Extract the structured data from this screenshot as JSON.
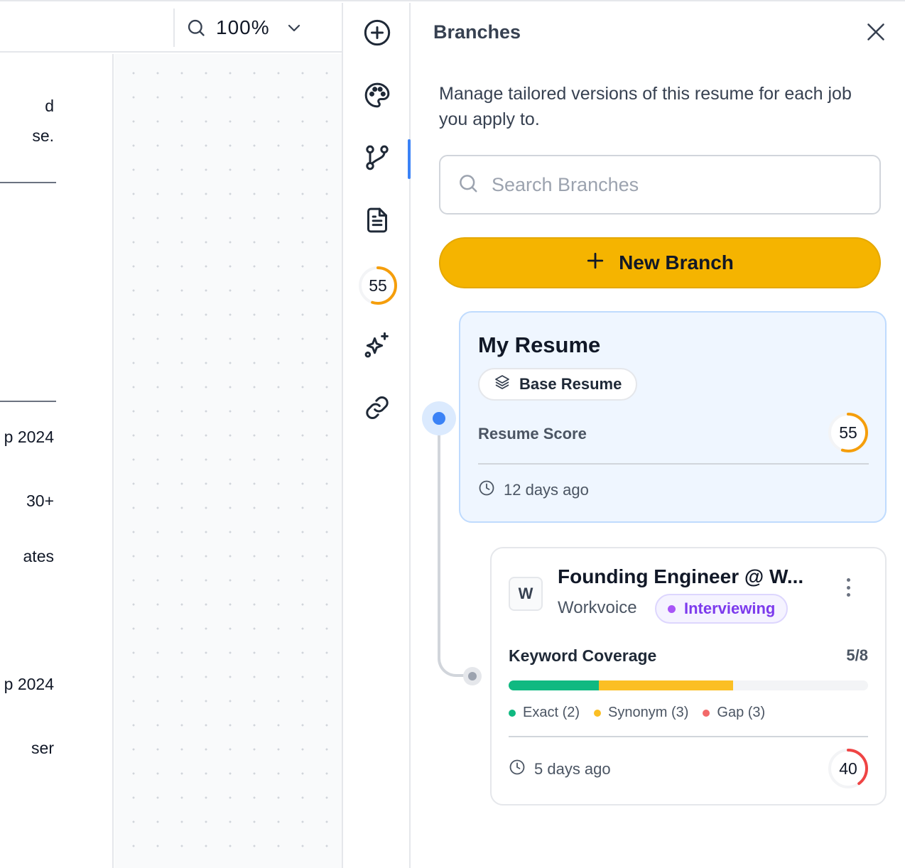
{
  "toolbar": {
    "zoom_value": "100%"
  },
  "document_fragments": [
    "d",
    "se.",
    "p 2024",
    "30+",
    "ates",
    "p 2024",
    "ser"
  ],
  "rail": {
    "score": "55",
    "score_fraction": 0.55,
    "items": [
      "plus-circle-icon",
      "palette-icon",
      "git-branch-icon",
      "document-icon",
      "score",
      "sparkles-icon",
      "link-icon"
    ],
    "active_item": "git-branch-icon"
  },
  "panel": {
    "title": "Branches",
    "description": "Manage tailored versions of this resume for each job you apply to.",
    "search_placeholder": "Search Branches",
    "new_branch_label": "New Branch"
  },
  "base_resume": {
    "title": "My Resume",
    "badge_label": "Base Resume",
    "score_label": "Resume Score",
    "score": "55",
    "score_fraction": 0.55,
    "updated": "12 days ago"
  },
  "branches": [
    {
      "logo_letter": "W",
      "title": "Founding Engineer @ W...",
      "company": "Workvoice",
      "status": "Interviewing",
      "keyword_label": "Keyword Coverage",
      "keyword_count": "5/8",
      "coverage": {
        "exact": 2,
        "synonym": 3,
        "gap": 3,
        "total": 8
      },
      "legend": {
        "exact": "Exact (2)",
        "synonym": "Synonym (3)",
        "gap": "Gap (3)"
      },
      "updated": "5 days ago",
      "score": "40",
      "score_fraction": 0.4
    }
  ],
  "colors": {
    "accent_yellow": "#f5b400",
    "active_blue": "#3b82f6",
    "score_orange": "#f59e0b",
    "score_red": "#ef4444",
    "exact_green": "#10b981",
    "synonym_yellow": "#fbbf24",
    "gap_red": "#ef4444",
    "status_purple": "#7c3aed"
  }
}
